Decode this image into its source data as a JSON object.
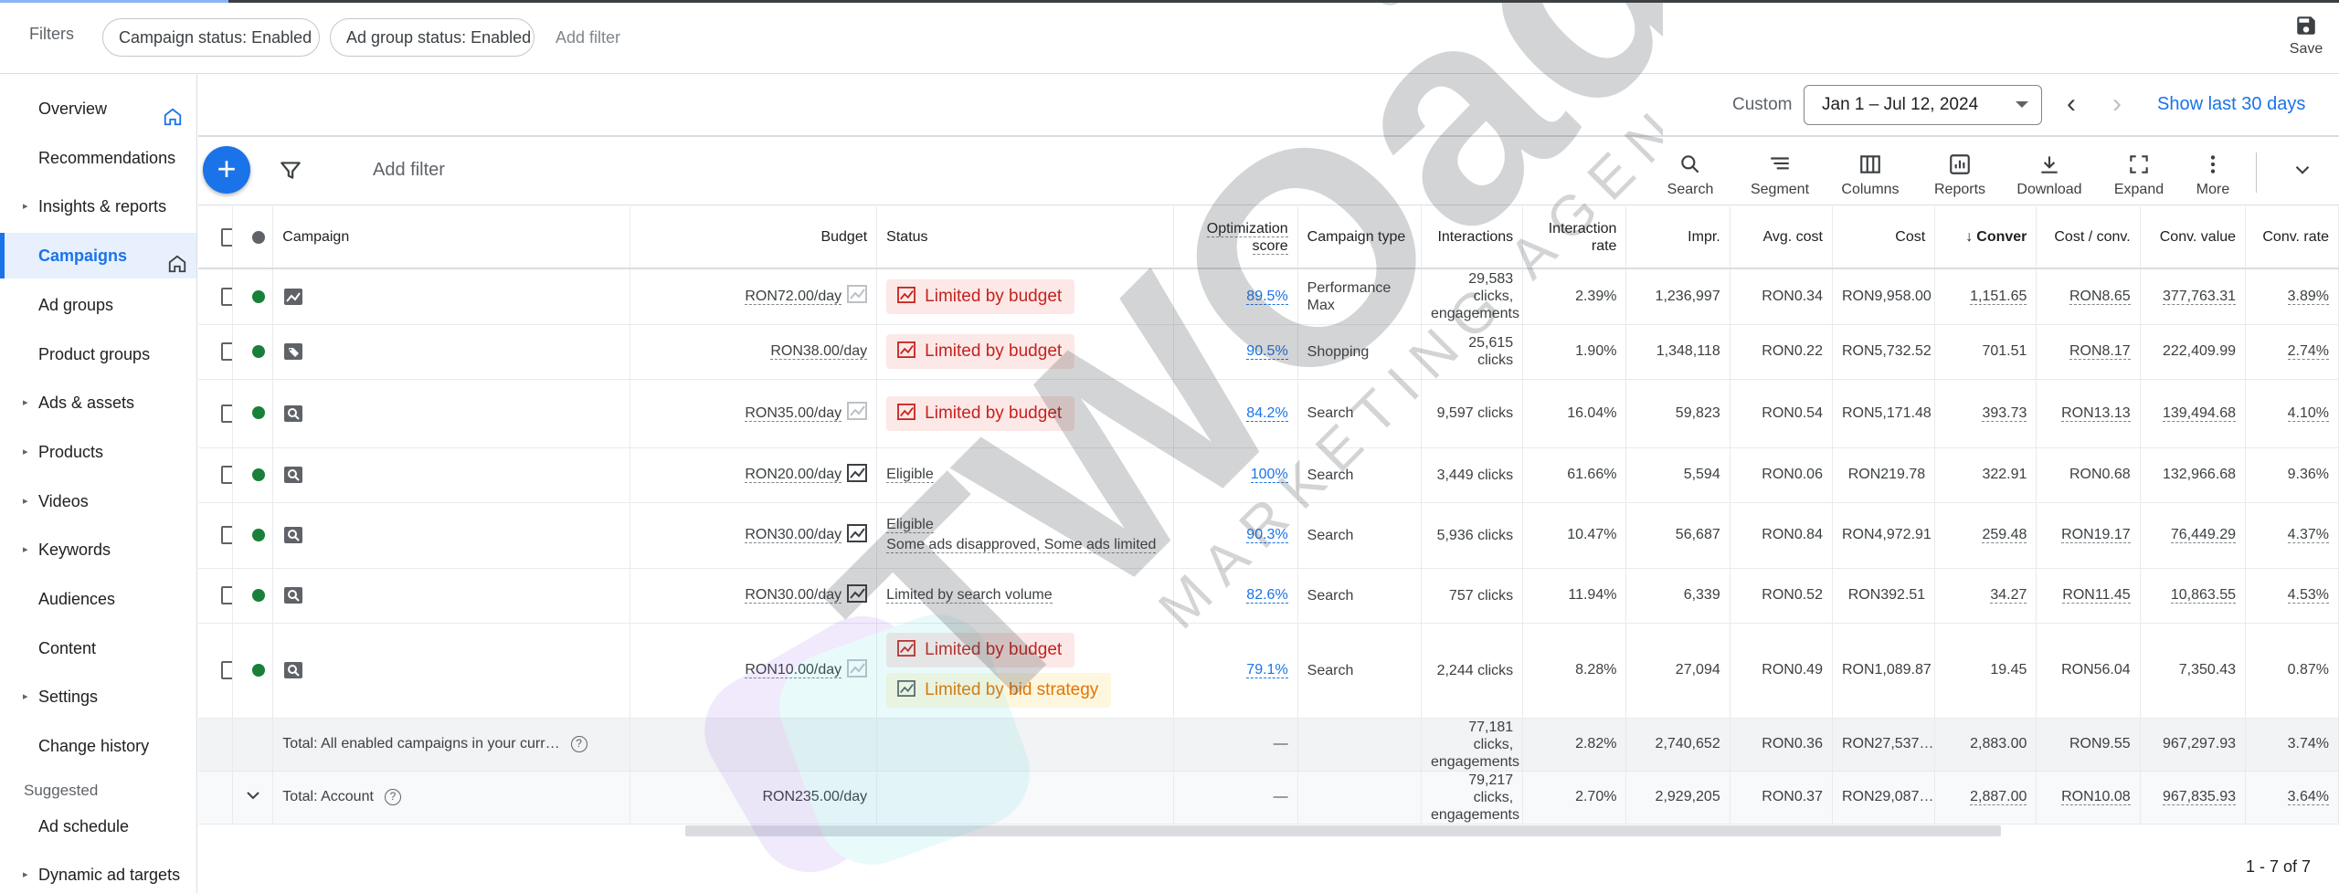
{
  "filters": {
    "label": "Filters",
    "chips": [
      "Campaign status: Enabled",
      "Ad group status: Enabled"
    ],
    "add_filter": "Add filter",
    "save_label": "Save"
  },
  "sidebar": {
    "items": [
      {
        "label": "Overview",
        "caret": false,
        "home": true,
        "active": false
      },
      {
        "label": "Recommendations",
        "caret": false,
        "home": false,
        "active": false
      },
      {
        "label": "Insights & reports",
        "caret": true,
        "home": false,
        "active": false
      },
      {
        "label": "Campaigns",
        "caret": false,
        "home": true,
        "active": true
      },
      {
        "label": "Ad groups",
        "caret": false,
        "home": false,
        "active": false
      },
      {
        "label": "Product groups",
        "caret": false,
        "home": false,
        "active": false
      },
      {
        "label": "Ads & assets",
        "caret": true,
        "home": false,
        "active": false
      },
      {
        "label": "Products",
        "caret": true,
        "home": false,
        "active": false
      },
      {
        "label": "Videos",
        "caret": true,
        "home": false,
        "active": false
      },
      {
        "label": "Keywords",
        "caret": true,
        "home": false,
        "active": false
      },
      {
        "label": "Audiences",
        "caret": false,
        "home": false,
        "active": false
      },
      {
        "label": "Content",
        "caret": false,
        "home": false,
        "active": false
      },
      {
        "label": "Settings",
        "caret": true,
        "home": false,
        "active": false
      },
      {
        "label": "Change history",
        "caret": false,
        "home": false,
        "active": false
      }
    ],
    "suggested_label": "Suggested",
    "suggested_items": [
      {
        "label": "Ad schedule",
        "caret": false
      },
      {
        "label": "Dynamic ad targets",
        "caret": true
      }
    ]
  },
  "datebar": {
    "custom_label": "Custom",
    "range": "Jan 1 – Jul 12, 2024",
    "show_last": "Show last 30 days"
  },
  "toolbar": {
    "add_filter": "Add filter",
    "tools": [
      {
        "label": "Search",
        "icon": "search-icon"
      },
      {
        "label": "Segment",
        "icon": "segment-icon"
      },
      {
        "label": "Columns",
        "icon": "columns-icon"
      },
      {
        "label": "Reports",
        "icon": "reports-icon"
      },
      {
        "label": "Download",
        "icon": "download-icon"
      },
      {
        "label": "Expand",
        "icon": "expand-icon"
      },
      {
        "label": "More",
        "icon": "more-vert-icon"
      }
    ]
  },
  "table": {
    "headers": {
      "campaign": "Campaign",
      "budget": "Budget",
      "status": "Status",
      "opt_score": "Optimization score",
      "campaign_type": "Campaign type",
      "interactions": "Interactions",
      "interaction_rate": "Interaction rate",
      "impr": "Impr.",
      "avg_cost": "Avg. cost",
      "cost": "Cost",
      "conversions": "Conver",
      "cost_conv": "Cost / conv.",
      "conv_value": "Conv. value",
      "conv_rate": "Conv. rate"
    },
    "rows": [
      {
        "icon": "performance-max-icon",
        "budget": "RON72.00/day",
        "status": [
          {
            "kind": "red",
            "text": "Limited by budget"
          }
        ],
        "opt_score": "89.5%",
        "type": "Performance Max",
        "interactions": "29,583 clicks, engagements",
        "interaction_rate": "2.39%",
        "impr": "1,236,997",
        "avg_cost": "RON0.34",
        "cost": "RON9,958.00",
        "conversions": "1,151.65",
        "cost_conv": "RON8.65",
        "conv_value": "377,763.31",
        "conv_rate": "3.89%"
      },
      {
        "icon": "shopping-tag-icon",
        "budget": "RON38.00/day",
        "status": [
          {
            "kind": "red",
            "text": "Limited by budget"
          }
        ],
        "opt_score": "90.5%",
        "type": "Shopping",
        "interactions": "25,615 clicks",
        "interaction_rate": "1.90%",
        "impr": "1,348,118",
        "avg_cost": "RON0.22",
        "cost": "RON5,732.52",
        "conversions": "701.51",
        "cost_conv": "RON8.17",
        "conv_value": "222,409.99",
        "conv_rate": "2.74%"
      },
      {
        "icon": "search-campaign-icon",
        "budget": "RON35.00/day",
        "status": [
          {
            "kind": "red",
            "text": "Limited by budget"
          }
        ],
        "opt_score": "84.2%",
        "type": "Search",
        "interactions": "9,597 clicks",
        "interaction_rate": "16.04%",
        "impr": "59,823",
        "avg_cost": "RON0.54",
        "cost": "RON5,171.48",
        "conversions": "393.73",
        "cost_conv": "RON13.13",
        "conv_value": "139,494.68",
        "conv_rate": "4.10%"
      },
      {
        "icon": "search-campaign-icon",
        "budget": "RON20.00/day",
        "status": [
          {
            "kind": "text",
            "text": "Eligible"
          }
        ],
        "opt_score": "100%",
        "type": "Search",
        "interactions": "3,449 clicks",
        "interaction_rate": "61.66%",
        "impr": "5,594",
        "avg_cost": "RON0.06",
        "cost": "RON219.78",
        "conversions": "322.91",
        "cost_conv": "RON0.68",
        "conv_value": "132,966.68",
        "conv_rate": "9.36%"
      },
      {
        "icon": "search-campaign-icon",
        "budget": "RON30.00/day",
        "status": [
          {
            "kind": "text",
            "text": "Eligible"
          },
          {
            "kind": "text",
            "text": "Some ads disapproved, Some ads limited"
          }
        ],
        "opt_score": "90.3%",
        "type": "Search",
        "interactions": "5,936 clicks",
        "interaction_rate": "10.47%",
        "impr": "56,687",
        "avg_cost": "RON0.84",
        "cost": "RON4,972.91",
        "conversions": "259.48",
        "cost_conv": "RON19.17",
        "conv_value": "76,449.29",
        "conv_rate": "4.37%"
      },
      {
        "icon": "search-campaign-icon",
        "budget": "RON30.00/day",
        "status": [
          {
            "kind": "text",
            "text": "Limited by search volume"
          }
        ],
        "opt_score": "82.6%",
        "type": "Search",
        "interactions": "757 clicks",
        "interaction_rate": "11.94%",
        "impr": "6,339",
        "avg_cost": "RON0.52",
        "cost": "RON392.51",
        "conversions": "34.27",
        "cost_conv": "RON11.45",
        "conv_value": "10,863.55",
        "conv_rate": "4.53%"
      },
      {
        "icon": "search-campaign-icon",
        "budget": "RON10.00/day",
        "status": [
          {
            "kind": "red",
            "text": "Limited by budget"
          },
          {
            "kind": "yellow",
            "text": "Limited by bid strategy"
          }
        ],
        "opt_score": "79.1%",
        "type": "Search",
        "interactions": "2,244 clicks",
        "interaction_rate": "8.28%",
        "impr": "27,094",
        "avg_cost": "RON0.49",
        "cost": "RON1,089.87",
        "conversions": "19.45",
        "cost_conv": "RON56.04",
        "conv_value": "7,350.43",
        "conv_rate": "0.87%"
      }
    ],
    "totals": [
      {
        "label": "Total: All enabled campaigns in your curr…",
        "budget": "",
        "opt_score": "—",
        "interactions": "77,181 clicks, engagements",
        "interaction_rate": "2.82%",
        "impr": "2,740,652",
        "avg_cost": "RON0.36",
        "cost": "RON27,537…",
        "conversions": "2,883.00",
        "cost_conv": "RON9.55",
        "conv_value": "967,297.93",
        "conv_rate": "3.74%"
      },
      {
        "label": "Total: Account",
        "budget": "RON235.00/day",
        "opt_score": "—",
        "interactions": "79,217 clicks, engagements",
        "interaction_rate": "2.70%",
        "impr": "2,929,205",
        "avg_cost": "RON0.37",
        "cost": "RON29,087…",
        "conversions": "2,887.00",
        "cost_conv": "RON10.08",
        "conv_value": "967,835.93",
        "conv_rate": "3.64%"
      }
    ]
  },
  "pager": "1 - 7 of 7",
  "watermark": {
    "brand": "TWOads",
    "sub": "MARKETING AGENCY",
    "mark": "®"
  },
  "colors": {
    "accent": "#1a73e8",
    "status_red": "#c5221f",
    "status_yellow": "#e37400",
    "enabled_dot": "#188038"
  }
}
